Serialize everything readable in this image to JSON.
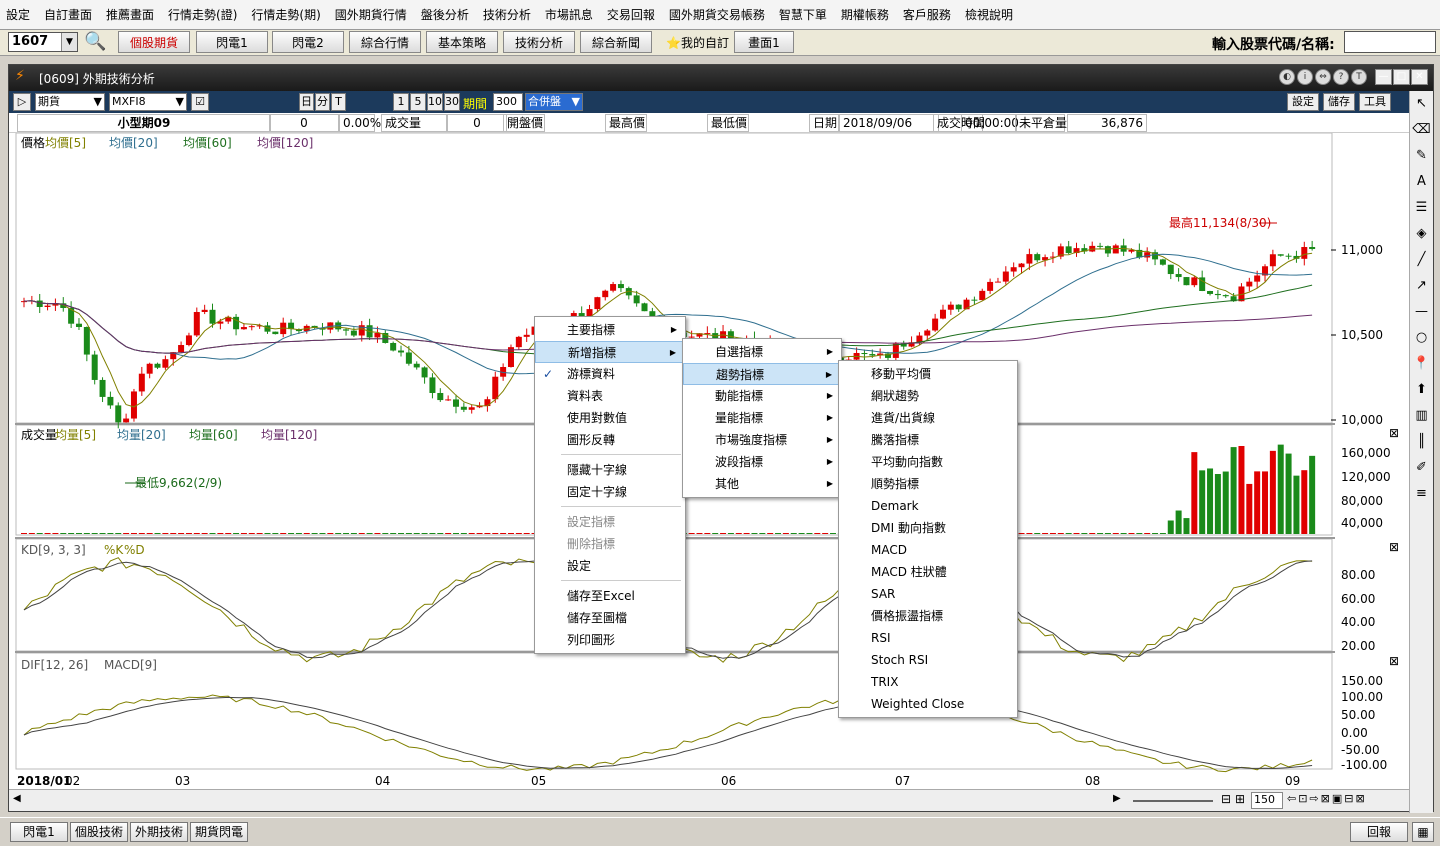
{
  "menubar": [
    "設定",
    "自訂畫面",
    "推薦畫面",
    "行情走勢(證)",
    "行情走勢(期)",
    "國外期貨行情",
    "盤後分析",
    "技術分析",
    "市場訊息",
    "交易回報",
    "國外期貨交易帳務",
    "智慧下單",
    "期權帳務",
    "客戶服務",
    "檢視說明"
  ],
  "toolbar": {
    "code": "1607",
    "buttons": [
      "個股期貨",
      "閃電1",
      "閃電2",
      "綜合行情",
      "基本策略",
      "技術分析",
      "綜合新聞"
    ],
    "my_custom": "我的自訂",
    "screen1": "畫面1",
    "stock_label": "輸入股票代碼/名稱:"
  },
  "window": {
    "title": "[0609] 外期技術分析",
    "type_select": "期貨",
    "symbol_select": "MXFI8",
    "period_small": [
      "日",
      "分",
      "T"
    ],
    "period_nums": [
      "1",
      "5",
      "10",
      "30"
    ],
    "period_label": "期間",
    "period_value": "300",
    "merge_label": "合併盤",
    "right_buttons": [
      "設定",
      "儲存",
      "工具"
    ]
  },
  "info": {
    "name": "小型期09",
    "value0": "0",
    "pct": "0.00%",
    "vol_label": "成交量",
    "vol": "0",
    "open_label": "開盤價",
    "high_label": "最高價",
    "low_label": "最低價",
    "date_label": "日期",
    "date": "2018/09/06",
    "time_label": "成交時間",
    "time": "00:00:00",
    "oi_label": "未平倉量",
    "oi": "36,876"
  },
  "panes": {
    "price_legend": [
      "價格",
      "均價[5]",
      "均價[20]",
      "均價[60]",
      "均價[120]"
    ],
    "price_ticks": [
      "11,000",
      "10,500",
      "10,000"
    ],
    "high_note": "最高11,134(8/30)",
    "low_note": "最低9,662(2/9)",
    "vol_legend": [
      "成交量",
      "均量[5]",
      "均量[20]",
      "均量[60]",
      "均量[120]"
    ],
    "vol_ticks": [
      "160,000",
      "120,000",
      "80,000",
      "40,000"
    ],
    "kd_legend": [
      "KD[9, 3, 3]",
      "%K",
      "%D"
    ],
    "kd_ticks": [
      "80.00",
      "60.00",
      "40.00",
      "20.00"
    ],
    "macd_legend": [
      "DIF[12, 26]",
      "MACD[9]"
    ],
    "macd_ticks": [
      "150.00",
      "100.00",
      "50.00",
      "0.00",
      "-50.00",
      "-100.00"
    ],
    "x_ticks": [
      "2018/01",
      "02",
      "03",
      "04",
      "05",
      "06",
      "07",
      "08",
      "09"
    ],
    "zoom": "150"
  },
  "colors": {
    "up": "#e00000",
    "down": "#1a8a1a",
    "ma5": "#808000",
    "ma20": "#2f6f8f",
    "ma60": "#1f6f1f",
    "ma120": "#6a2f6a"
  },
  "context_menu": {
    "items": [
      "主要指標",
      "新增指標",
      "游標資料",
      "資料表",
      "使用對數值",
      "圖形反轉",
      "隱藏十字線",
      "固定十字線",
      "設定指標",
      "刪除指標",
      "設定",
      "儲存至Excel",
      "儲存至圖檔",
      "列印圖形"
    ]
  },
  "submenu1": [
    "自選指標",
    "趨勢指標",
    "動能指標",
    "量能指標",
    "市場強度指標",
    "波段指標",
    "其他"
  ],
  "submenu2": [
    "移動平均價",
    "網狀趨勢",
    "進貨/出貨線",
    "騰落指標",
    "平均動向指數",
    "順勢指標",
    "Demark",
    "DMI 動向指數",
    "MACD",
    "MACD 柱狀體",
    "SAR",
    "價格振盪指標",
    "RSI",
    "Stoch RSI",
    "TRIX",
    "Weighted Close"
  ],
  "taskbar": [
    "閃電1",
    "個股技術",
    "外期技術",
    "期貨閃電"
  ],
  "taskbar_right": "回報"
}
